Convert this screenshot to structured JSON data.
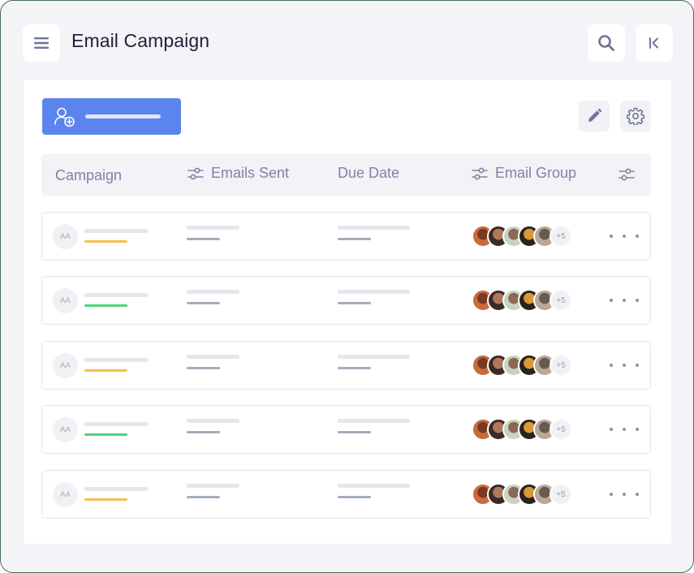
{
  "header": {
    "title": "Email Campaign",
    "menu_icon": "hamburger-menu-icon",
    "search_icon": "search-icon",
    "collapse_icon": "collapse-sidebar-icon"
  },
  "toolbar": {
    "add_button_icon": "add-user-icon",
    "edit_icon": "pencil-icon",
    "settings_icon": "gear-icon"
  },
  "table": {
    "columns": [
      "Campaign",
      "Emails Sent",
      "Due Date",
      "Email Group"
    ],
    "filter_icon": "sliders-icon",
    "rows": [
      {
        "initials": "AA",
        "status_color": "#f5bf4f",
        "extra_members": "+5"
      },
      {
        "initials": "AA",
        "status_color": "#4fd47a",
        "extra_members": "+5"
      },
      {
        "initials": "AA",
        "status_color": "#f5bf4f",
        "extra_members": "+5"
      },
      {
        "initials": "AA",
        "status_color": "#4fd47a",
        "extra_members": "+5"
      },
      {
        "initials": "AA",
        "status_color": "#f5bf4f",
        "extra_members": "+5"
      }
    ]
  },
  "colors": {
    "accent": "#5b84ee",
    "background": "#f3f3f8",
    "header_text": "#7d84a4"
  }
}
